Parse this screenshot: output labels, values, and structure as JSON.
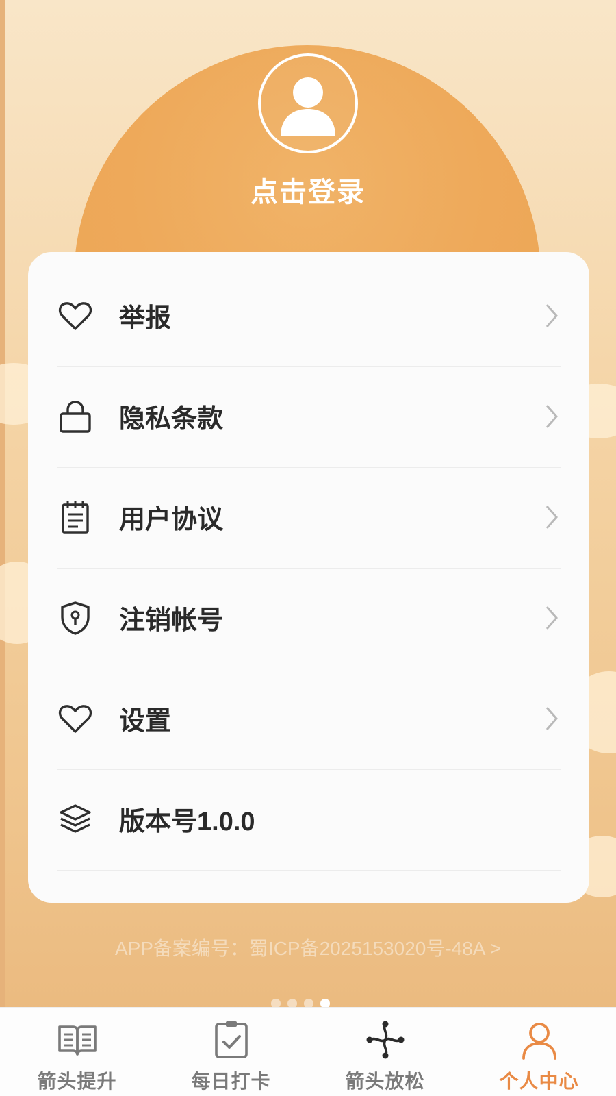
{
  "header": {
    "avatar_icon": "user-avatar-icon",
    "login_label": "点击登录"
  },
  "menu": {
    "items": [
      {
        "label": "举报",
        "icon": "heart-icon",
        "has_chevron": true
      },
      {
        "label": "隐私条款",
        "icon": "lock-icon",
        "has_chevron": true
      },
      {
        "label": "用户协议",
        "icon": "notepad-icon",
        "has_chevron": true
      },
      {
        "label": "注销帐号",
        "icon": "shield-keyhole-icon",
        "has_chevron": true
      },
      {
        "label": "设置",
        "icon": "heart-icon",
        "has_chevron": true
      },
      {
        "label": "版本号1.0.0",
        "icon": "layers-icon",
        "has_chevron": false
      }
    ]
  },
  "footer": {
    "icp_text": "APP备案编号：蜀ICP备2025153020号-48A >"
  },
  "pager": {
    "count": 4,
    "active_index": 3
  },
  "tabbar": {
    "tabs": [
      {
        "label": "箭头提升",
        "icon": "open-book-icon",
        "active": false
      },
      {
        "label": "每日打卡",
        "icon": "checkbox-card-icon",
        "active": false
      },
      {
        "label": "箭头放松",
        "icon": "arrows-knot-icon",
        "active": false
      },
      {
        "label": "个人中心",
        "icon": "person-icon",
        "active": true
      }
    ]
  },
  "colors": {
    "accent": "#e98a45",
    "sun": "#eea95a",
    "background_light": "#f9e6c8",
    "card": "#fbfbfb",
    "text_dark": "#2a2a2a",
    "tab_inactive": "#7a7a7a"
  }
}
